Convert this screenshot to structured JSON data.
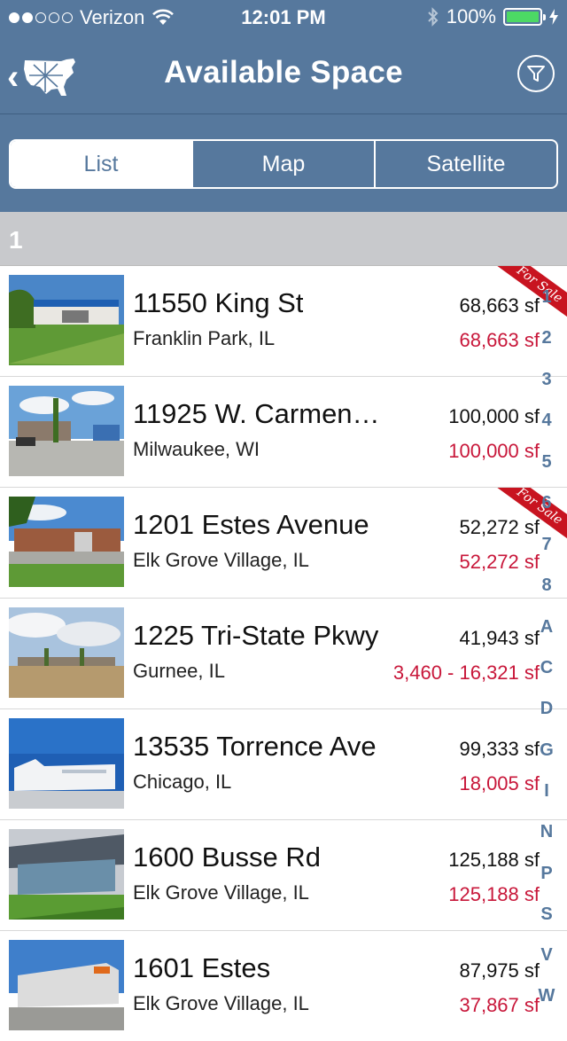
{
  "status_bar": {
    "carrier": "Verizon",
    "time": "12:01 PM",
    "battery": "100%",
    "signal_dots_filled": 2,
    "signal_dots_total": 5
  },
  "nav": {
    "title": "Available Space",
    "back_icon": "chevron-left-icon",
    "logo_icon": "usa-map-logo-icon",
    "filter_icon": "filter-icon"
  },
  "segments": [
    "List",
    "Map",
    "Satellite"
  ],
  "section_header": "1",
  "listings": [
    {
      "address": "11550 King St",
      "city": "Franklin Park, IL",
      "size": "68,663 sf",
      "available": "68,663 sf",
      "ribbon": "For Sale"
    },
    {
      "address": "11925 W. Carmen…",
      "city": "Milwaukee, WI",
      "size": "100,000 sf",
      "available": "100,000 sf",
      "ribbon": ""
    },
    {
      "address": "1201 Estes Avenue",
      "city": "Elk Grove Village, IL",
      "size": "52,272 sf",
      "available": "52,272 sf",
      "ribbon": "For Sale"
    },
    {
      "address": "1225 Tri-State Pkwy",
      "city": "Gurnee, IL",
      "size": "41,943 sf",
      "available": "3,460 - 16,321 sf",
      "ribbon": ""
    },
    {
      "address": "13535 Torrence Ave",
      "city": "Chicago, IL",
      "size": "99,333 sf",
      "available": "18,005 sf",
      "ribbon": ""
    },
    {
      "address": "1600 Busse Rd",
      "city": "Elk Grove Village, IL",
      "size": "125,188 sf",
      "available": "125,188 sf",
      "ribbon": ""
    },
    {
      "address": "1601 Estes",
      "city": "Elk Grove Village, IL",
      "size": "87,975 sf",
      "available": "37,867 sf",
      "ribbon": ""
    }
  ],
  "index_letters": [
    "1",
    "2",
    "3",
    "4",
    "5",
    "6",
    "7",
    "8",
    "A",
    "C",
    "D",
    "G",
    "I",
    "N",
    "P",
    "S",
    "V",
    "W"
  ],
  "colors": {
    "header_blue": "#56789d",
    "price_red": "#c8173a",
    "section_gray": "#c8c9cc",
    "ribbon_red": "#c81420"
  }
}
